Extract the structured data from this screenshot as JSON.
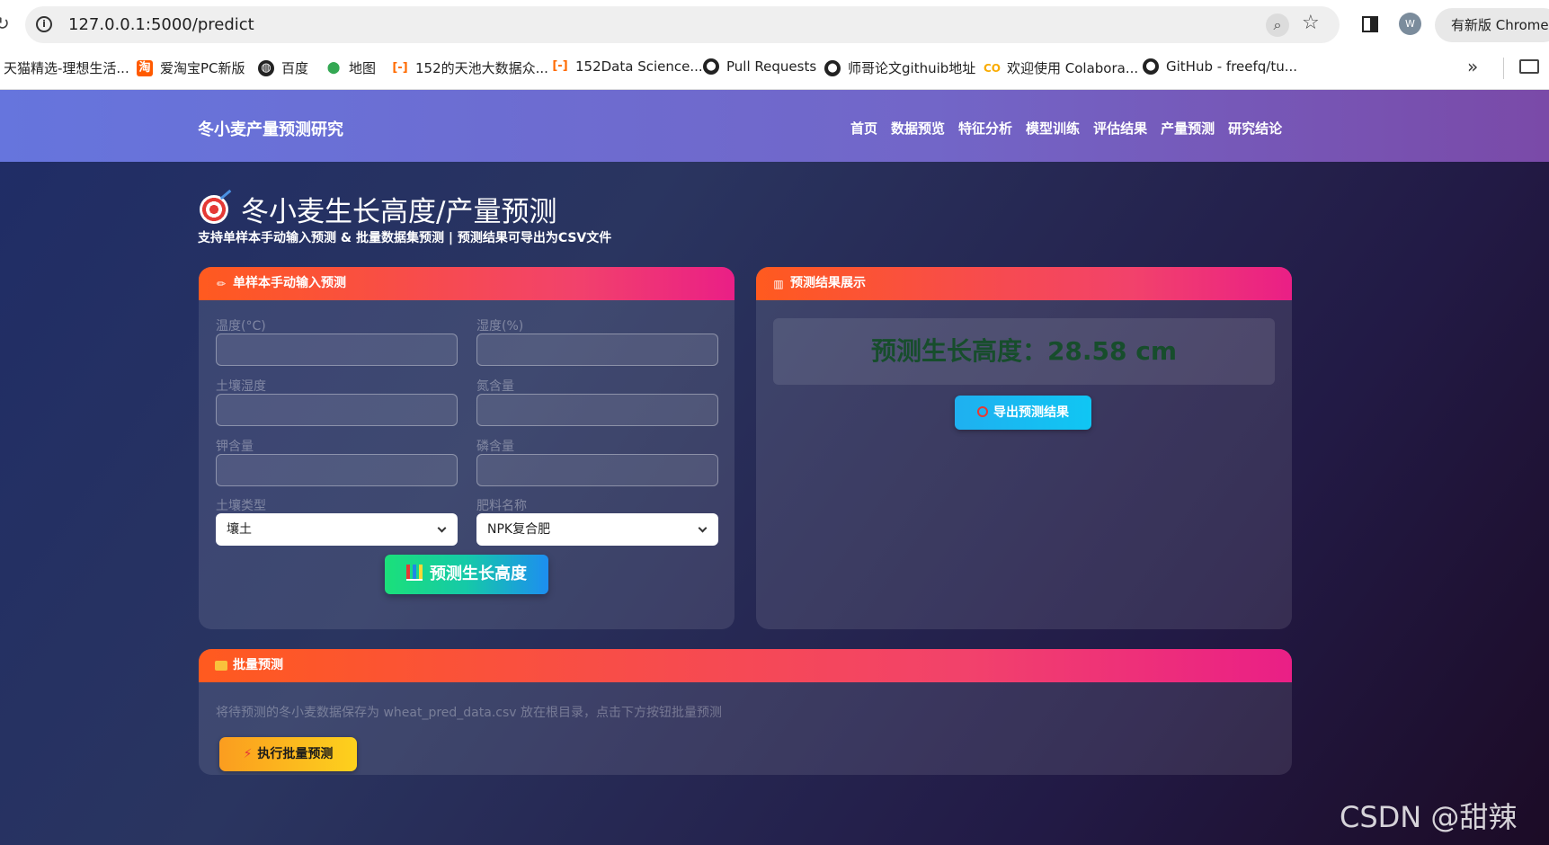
{
  "browser": {
    "url": "127.0.0.1:5000/predict",
    "profile_initial": "W",
    "update_label": "有新版 Chrome",
    "bookmarks": [
      {
        "label": "天猫精选-理想生活...",
        "icon": "tmall-icon"
      },
      {
        "label": "爱淘宝PC新版",
        "icon": "taobao-icon"
      },
      {
        "label": "百度",
        "icon": "globe-icon"
      },
      {
        "label": "地图",
        "icon": "maps-pin-icon"
      },
      {
        "label": "152的天池大数据众...",
        "icon": "tianchi-icon"
      },
      {
        "label": "152Data Science...",
        "icon": "tianchi-icon"
      },
      {
        "label": "Pull Requests",
        "icon": "github-icon"
      },
      {
        "label": "师哥论文githuib地址",
        "icon": "github-icon"
      },
      {
        "label": "欢迎使用 Colabora...",
        "icon": "colab-icon"
      },
      {
        "label": "GitHub - freefq/tu...",
        "icon": "github-icon"
      }
    ]
  },
  "navbar": {
    "brand": "冬小麦产量预测研究",
    "links": [
      "首页",
      "数据预览",
      "特征分析",
      "模型训练",
      "评估结果",
      "产量预测",
      "研究结论"
    ]
  },
  "header": {
    "title": "冬小麦生长高度/产量预测",
    "subtitle": "支持单样本手动输入预测 & 批量数据集预测 | 预测结果可导出为CSV文件"
  },
  "manual_card": {
    "title": "单样本手动输入预测",
    "fields": {
      "temperature": "温度(°C)",
      "humidity": "湿度(%)",
      "soil_moisture": "土壤湿度",
      "nitrogen": "氮含量",
      "potassium": "钾含量",
      "phosphorus": "磷含量",
      "soil_type": "土壤类型",
      "fertilizer": "肥料名称"
    },
    "soil_type_value": "壤土",
    "fertilizer_value": "NPK复合肥",
    "predict_label": "预测生长高度"
  },
  "result_card": {
    "title": "预测结果展示",
    "result_text": "预测生长高度：28.58 cm",
    "export_label": "导出预测结果"
  },
  "batch_card": {
    "title": "批量预测",
    "hint": "将待预测的冬小麦数据保存为 wheat_pred_data.csv 放在根目录，点击下方按钮批量预测",
    "button_label": "执行批量预测"
  },
  "watermark": "CSDN @甜辣uu",
  "colors": {
    "navbar": "#6a6fd4",
    "card_header": "#f2426b",
    "predict_button": "#15c9a8",
    "export_button": "#10c6f3",
    "batch_button": "#fdb61e",
    "result_text": "#174d2c"
  }
}
